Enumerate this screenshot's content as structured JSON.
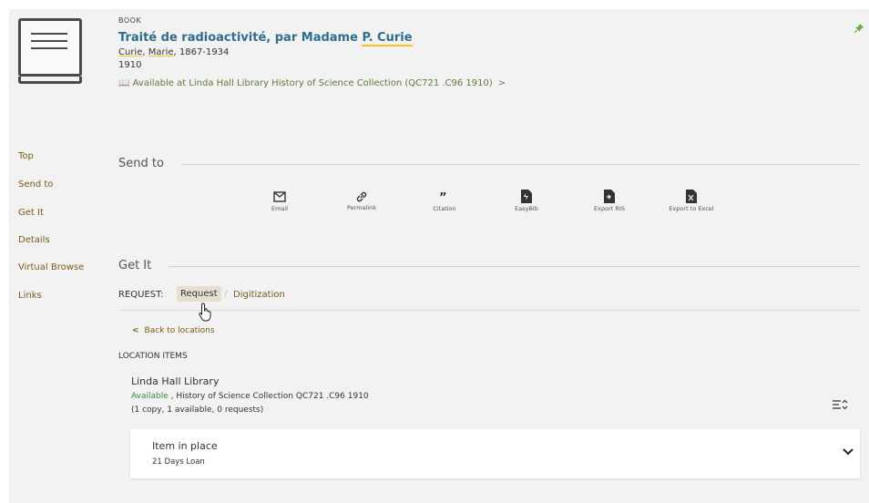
{
  "record": {
    "type": "BOOK",
    "title_part1": "Traité de radioactivité, par Madame ",
    "title_part2": "P. Curie",
    "author_surname": "Curie",
    "author_sep1": ", ",
    "author_given": "Marie",
    "author_dates": ", 1867-1934",
    "year": "1910",
    "availability": "Available at Linda Hall Library  History of Science Collection (QC721 .C96 1910)",
    "availability_chevron": ">"
  },
  "nav": {
    "items": [
      "Top",
      "Send to",
      "Get It",
      "Details",
      "Virtual Browse",
      "Links"
    ]
  },
  "send_to": {
    "title": "Send to",
    "actions": [
      {
        "label": "Email",
        "icon": "envelope-icon"
      },
      {
        "label": "Permalink",
        "icon": "link-icon"
      },
      {
        "label": "Citation",
        "icon": "quote-icon"
      },
      {
        "label": "EasyBib",
        "icon": "easybib-icon"
      },
      {
        "label": "Export RIS",
        "icon": "export-ris-icon"
      },
      {
        "label": "Export to Excel",
        "icon": "excel-icon"
      }
    ]
  },
  "get_it": {
    "title": "Get It",
    "request_label": "REQUEST:",
    "request_active": "Request",
    "request_sep": "/",
    "request_other": "Digitization",
    "back_chevron": "<",
    "back_label": "Back to locations",
    "location_items_label": "LOCATION ITEMS",
    "location": {
      "name": "Linda Hall Library",
      "status": "Available",
      "detail": " , History of Science Collection QC721 .C96 1910",
      "copies": "(1 copy, 1 available, 0 requests)"
    },
    "item": {
      "status": "Item in place",
      "policy": "21 Days Loan"
    }
  },
  "colors": {
    "link": "#7a5a1a",
    "title": "#2f6d8d",
    "available": "#3f8a3f",
    "highlight": "#f5c518",
    "pin": "#6aa84f"
  }
}
